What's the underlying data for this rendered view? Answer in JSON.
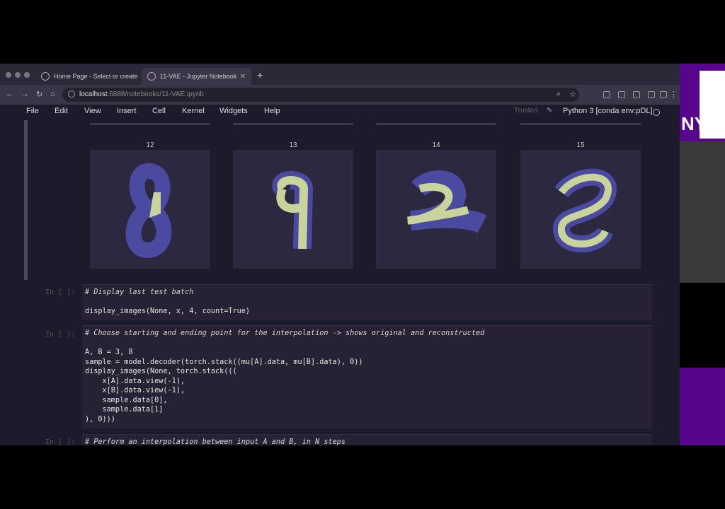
{
  "browser": {
    "tabs": [
      {
        "title": "Home Page - Select or create a"
      },
      {
        "title": "11-VAE - Jupyter Notebook"
      }
    ],
    "new_tab": "+",
    "url_host": "localhost",
    "url_rest": ":8888/notebooks/11-VAE.ipynb"
  },
  "menubar": {
    "items": [
      "File",
      "Edit",
      "View",
      "Insert",
      "Cell",
      "Kernel",
      "Widgets",
      "Help"
    ],
    "trusted": "Trusted",
    "kernel": "Python 3 [conda env:pDL]"
  },
  "images": [
    {
      "label": "12"
    },
    {
      "label": "13"
    },
    {
      "label": "14"
    },
    {
      "label": "15"
    }
  ],
  "cells": [
    {
      "prompt": "In [ ]:",
      "lines": [
        "# Display last test batch",
        "",
        "display_images(None, x, 4, count=True)"
      ]
    },
    {
      "prompt": "In [ ]:",
      "lines": [
        "# Choose starting and ending point for the interpolation -> shows original and reconstructed",
        "",
        "A, B = 3, 8",
        "sample = model.decoder(torch.stack((mu[A].data, mu[B].data), 0))",
        "display_images(None, torch.stack(((",
        "    x[A].data.view(-1),",
        "    x[B].data.view(-1),",
        "    sample.data[0],",
        "    sample.data[1]",
        "), 0)))"
      ]
    },
    {
      "prompt": "In [ ]:",
      "lines": [
        "# Perform an interpolation between input A and B, in N steps"
      ]
    }
  ],
  "side": {
    "logo_text": "NY"
  },
  "colors": {
    "accent": "#57068c",
    "digit_fg": "#c9d49a",
    "digit_halo": "#4a4aa0"
  }
}
